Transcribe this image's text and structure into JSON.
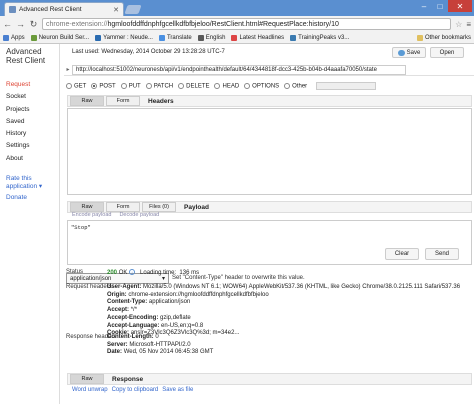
{
  "browser": {
    "tab_title": "Advanced Rest Client",
    "address_scheme": "chrome-extension://",
    "address_rest": "hgmloofddffdnphfgcellkdfbfbjeloo/RestClient.html#RequestPlace:history/10",
    "bookmarks": [
      {
        "label": "Apps",
        "color": "#4a7fd0"
      },
      {
        "label": "Neuron Build Ser...",
        "color": "#6a9a3a"
      },
      {
        "label": "Yammer : Neude...",
        "color": "#2a6bb0"
      },
      {
        "label": "Translate",
        "color": "#4a90e2"
      },
      {
        "label": "English",
        "color": "#5a5a5a"
      },
      {
        "label": "Latest Headlines",
        "color": "#d44"
      },
      {
        "label": "TrainingPeaks v3...",
        "color": "#3a7ab0"
      }
    ],
    "other_bookmarks": "Other bookmarks"
  },
  "sidebar": {
    "title": "Advanced Rest Client",
    "items": [
      "Request",
      "Socket",
      "Projects",
      "Saved",
      "History",
      "Settings",
      "About"
    ],
    "rate": "Rate this application ▾",
    "donate": "Donate"
  },
  "request": {
    "last_used": "Last used: Wednesday, 2014 October 29 13:28:28 UTC-7",
    "save": "Save",
    "open": "Open",
    "url": "http://localhost:51002/neuronesb/api/v1/endpointhealth/default/64/4344818f-dcc3-425b-b04b-d4aaafa70050/state",
    "methods": [
      "GET",
      "POST",
      "PUT",
      "PATCH",
      "DELETE",
      "HEAD",
      "OPTIONS",
      "Other"
    ],
    "selected_method": "POST",
    "headers_tabs": [
      "Raw",
      "Form"
    ],
    "headers_label": "Headers",
    "payload_tabs": [
      "Raw",
      "Form",
      "Files (0)"
    ],
    "payload_label": "Payload",
    "encode": "Encode payload",
    "decode": "Decode payload",
    "payload_body": "\"Stop\"",
    "content_type": "application/json",
    "hint_prefix": "Set \"Content-Type\" header to overwrite this value.",
    "clear": "Clear",
    "send": "Send"
  },
  "response": {
    "status_label": "Status",
    "status_code": "200",
    "status_text": "OK",
    "loading_label": "Loading time:",
    "loading_value": "136 ms",
    "request_headers_label": "Request headers",
    "request_headers": [
      {
        "k": "User-Agent:",
        "v": "Mozilla/5.0 (Windows NT 6.1; WOW64) AppleWebKit/537.36 (KHTML, like Gecko) Chrome/38.0.2125.111 Safari/537.36"
      },
      {
        "k": "Origin:",
        "v": "chrome-extension://hgmloofddffdnphfgcellkdfbfbjeloo"
      },
      {
        "k": "Content-Type:",
        "v": "application/json"
      },
      {
        "k": "Accept:",
        "v": "*/*"
      },
      {
        "k": "Accept-Encoding:",
        "v": "gzip,deflate"
      },
      {
        "k": "Accept-Language:",
        "v": "en-US,en;q=0.8"
      },
      {
        "k": "Cookie:",
        "v": "anslr=Z3Vlc3Q6Z3Vlc3Q%3d; m=34e2..."
      }
    ],
    "response_headers_label": "Response headers",
    "response_headers": [
      {
        "k": "Content-Length:",
        "v": "0"
      },
      {
        "k": "Server:",
        "v": "Microsoft-HTTPAPI/2.0"
      },
      {
        "k": "Date:",
        "v": "Wed, 05 Nov 2014 06:45:38 GMT"
      }
    ],
    "tab_raw": "Raw",
    "tab_label": "Response",
    "word_unwrap": "Word unwrap",
    "copy": "Copy to clipboard",
    "save_file": "Save as file"
  }
}
